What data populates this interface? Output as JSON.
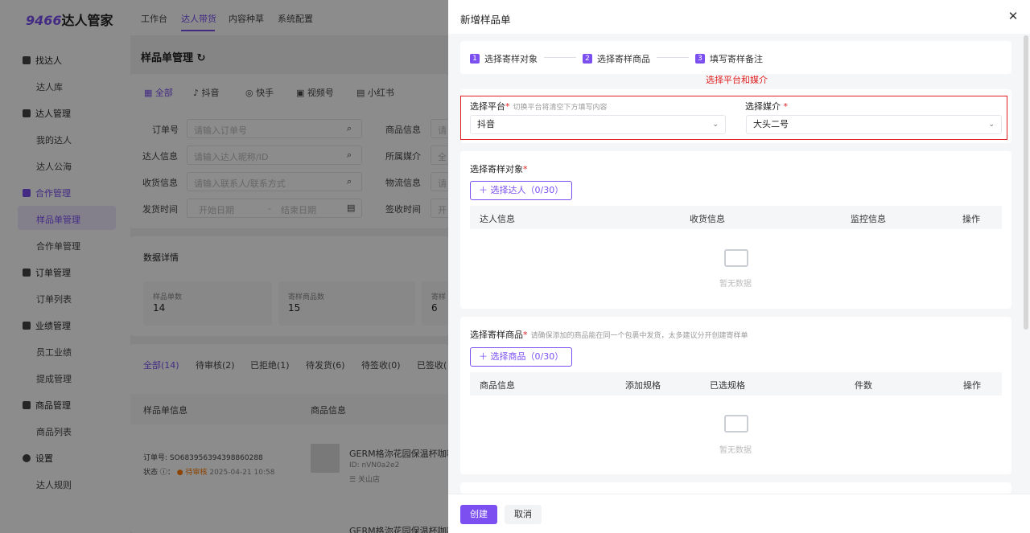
{
  "logo": {
    "num": "9466",
    "text": "达人管家"
  },
  "topnav": [
    "工作台",
    "达人带货",
    "内容种草",
    "系统配置"
  ],
  "sidebar": {
    "groups": [
      {
        "label": "找达人",
        "items": [
          "达人库"
        ]
      },
      {
        "label": "达人管理",
        "items": [
          "我的达人",
          "达人公海"
        ]
      },
      {
        "label": "合作管理",
        "items": [
          "样品单管理",
          "合作单管理"
        ]
      },
      {
        "label": "订单管理",
        "items": [
          "订单列表"
        ]
      },
      {
        "label": "业绩管理",
        "items": [
          "员工业绩",
          "提成管理"
        ]
      },
      {
        "label": "商品管理",
        "items": [
          "商品列表"
        ]
      },
      {
        "label": "设置",
        "items": [
          "达人规则"
        ]
      }
    ]
  },
  "page": {
    "title": "样品单管理",
    "platform_tabs": [
      "全部",
      "抖音",
      "快手",
      "视频号",
      "小红书"
    ],
    "filters": [
      {
        "label": "订单号",
        "placeholder": "请输入订单号"
      },
      {
        "label": "达人信息",
        "placeholder": "请输入达人昵称/ID"
      },
      {
        "label": "收货信息",
        "placeholder": "请输入联系人/联系方式"
      },
      {
        "label": "发货时间",
        "start": "开始日期",
        "sep": "-",
        "end": "结束日期"
      }
    ],
    "filters_right": [
      {
        "label": "商品信息",
        "placeholder": "请"
      },
      {
        "label": "所属媒介",
        "placeholder": "全"
      },
      {
        "label": "物流信息",
        "placeholder": "请"
      },
      {
        "label": "签收时间",
        "placeholder": "开"
      }
    ],
    "stats_title": "数据详情",
    "stats": [
      {
        "label": "样品单数",
        "value": "14"
      },
      {
        "label": "寄样商品数",
        "value": "15"
      },
      {
        "label": "寄样",
        "value": "6"
      }
    ],
    "status_tabs": [
      "全部(14)",
      "待审核(2)",
      "已拒绝(1)",
      "待发货(6)",
      "待签收(0)",
      "已签收("
    ],
    "table_headers": [
      "样品单信息",
      "商品信息"
    ],
    "row": {
      "order_label": "订单号:",
      "order_no": "SO683956394398860288",
      "status_label": "状态",
      "status": "待审核",
      "time": "2025-04-21 10:58",
      "product": "GERM格沵花园保温杯咖啡",
      "id": "ID: nVN0a2e2",
      "shop": "关山店"
    },
    "row2_product": "GERM格沵花园保温杯咖啡"
  },
  "drawer": {
    "title": "新增样品单",
    "steps": [
      "选择寄样对象",
      "选择寄样商品",
      "填写寄样备注"
    ],
    "annotation": "选择平台和媒介",
    "platform": {
      "label": "选择平台",
      "hint": "切换平台将清空下方填写内容",
      "value": "抖音"
    },
    "media": {
      "label": "选择媒介",
      "value": "大头二号"
    },
    "target": {
      "label": "选择寄样对象",
      "button": "选择达人（0/30）",
      "headers": [
        "达人信息",
        "收货信息",
        "监控信息",
        "操作"
      ],
      "empty": "暂无数据"
    },
    "goods": {
      "label": "选择寄样商品",
      "hint": "请确保添加的商品能在同一个包裹中发货，太多建议分开创建寄样单",
      "button": "选择商品（0/30）",
      "headers": [
        "商品信息",
        "添加规格",
        "已选规格",
        "件数",
        "操作"
      ],
      "empty": "暂无数据"
    },
    "create": "创建",
    "cancel": "取消"
  }
}
